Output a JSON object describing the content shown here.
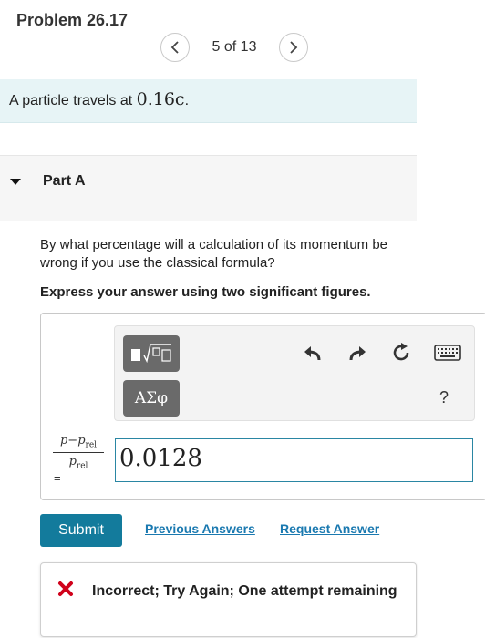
{
  "header": {
    "title": "Problem 26.17",
    "pager_text": "5 of 13"
  },
  "intro": {
    "prefix": "A particle travels at ",
    "speed": "0.16c",
    "suffix": "."
  },
  "part": {
    "label": "Part A",
    "question": "By what percentage will a calculation of its momentum be wrong if you use the classical formula?",
    "instruction": "Express your answer using two significant figures."
  },
  "toolbar": {
    "symbols_label": "ΑΣφ",
    "help_label": "?",
    "icons": [
      "templates-icon",
      "undo-icon",
      "redo-icon",
      "reset-icon",
      "keyboard-icon"
    ]
  },
  "answer": {
    "fraction_numerator_p": "p",
    "fraction_numerator_minus": "−",
    "fraction_numerator_prel": "p",
    "fraction_sub": "rel",
    "fraction_denominator_p": "p",
    "equals": "=",
    "value": "0.0128"
  },
  "actions": {
    "submit_label": "Submit",
    "previous_answers_label": "Previous Answers",
    "request_answer_label": "Request Answer"
  },
  "feedback": {
    "text": "Incorrect; Try Again; One attempt remaining"
  },
  "colors": {
    "accent": "#137b9c",
    "intro_bg": "#e7f4f6",
    "error": "#d0021b",
    "link": "#1a79b0"
  }
}
